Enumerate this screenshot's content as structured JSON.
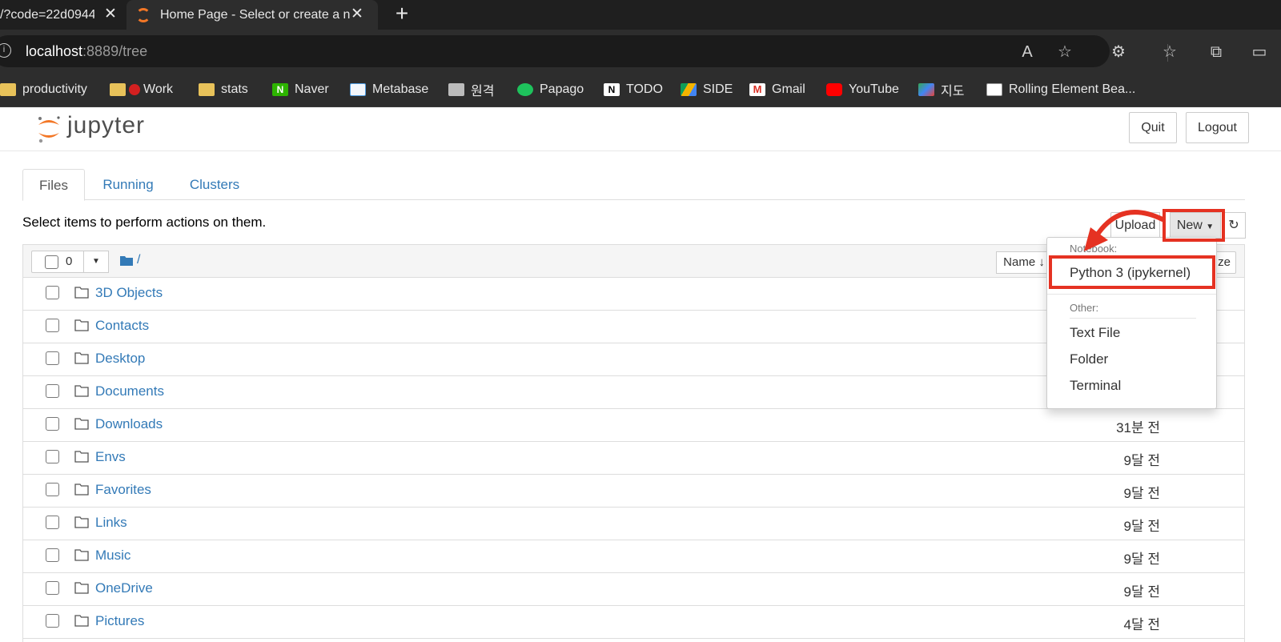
{
  "browser": {
    "tabs": [
      {
        "title": "/?code=22d0944",
        "active": false
      },
      {
        "title": "Home Page - Select or create a n",
        "active": true
      }
    ],
    "new_tab_symbol": "+",
    "close_symbol": "✕",
    "url_host": "localhost",
    "url_rest": ":8889/tree",
    "bookmarks": [
      {
        "label": "productivity",
        "icon": "folder-icon"
      },
      {
        "label": "Work",
        "icon": "folder-icon"
      },
      {
        "label": "stats",
        "icon": "folder-icon"
      },
      {
        "label": "Naver",
        "icon": "naver-icon"
      },
      {
        "label": "Metabase",
        "icon": "metabase-icon"
      },
      {
        "label": "원격",
        "icon": "remote-icon"
      },
      {
        "label": "Papago",
        "icon": "papago-icon"
      },
      {
        "label": "TODO",
        "icon": "notion-icon"
      },
      {
        "label": "SIDE",
        "icon": "drive-icon"
      },
      {
        "label": "Gmail",
        "icon": "gmail-icon"
      },
      {
        "label": "YouTube",
        "icon": "youtube-icon"
      },
      {
        "label": "지도",
        "icon": "maps-icon"
      },
      {
        "label": "Rolling Element Bea...",
        "icon": "site-icon"
      }
    ]
  },
  "jupyter": {
    "logo_text": "jupyter",
    "quit_label": "Quit",
    "logout_label": "Logout",
    "tabs": [
      "Files",
      "Running",
      "Clusters"
    ],
    "instruction": "Select items to perform actions on them.",
    "upload_label": "Upload",
    "new_label": "New",
    "selected_count": "0",
    "breadcrumb": "/",
    "sort_name_label": "Name",
    "sort_size_label": "ze",
    "files": [
      {
        "name": "3D Objects",
        "modified": ""
      },
      {
        "name": "Contacts",
        "modified": ""
      },
      {
        "name": "Desktop",
        "modified": ""
      },
      {
        "name": "Documents",
        "modified": ""
      },
      {
        "name": "Downloads",
        "modified": "31분 전"
      },
      {
        "name": "Envs",
        "modified": "9달 전"
      },
      {
        "name": "Favorites",
        "modified": "9달 전"
      },
      {
        "name": "Links",
        "modified": "9달 전"
      },
      {
        "name": "Music",
        "modified": "9달 전"
      },
      {
        "name": "OneDrive",
        "modified": "9달 전"
      },
      {
        "name": "Pictures",
        "modified": "4달 전"
      }
    ],
    "new_menu": {
      "notebook_header": "Notebook:",
      "python_kernel": "Python 3 (ipykernel)",
      "other_header": "Other:",
      "text_file": "Text File",
      "folder": "Folder",
      "terminal": "Terminal"
    }
  },
  "colors": {
    "annotation_red": "#e53222",
    "link_blue": "#337ab7",
    "jupyter_orange": "#f37726"
  }
}
